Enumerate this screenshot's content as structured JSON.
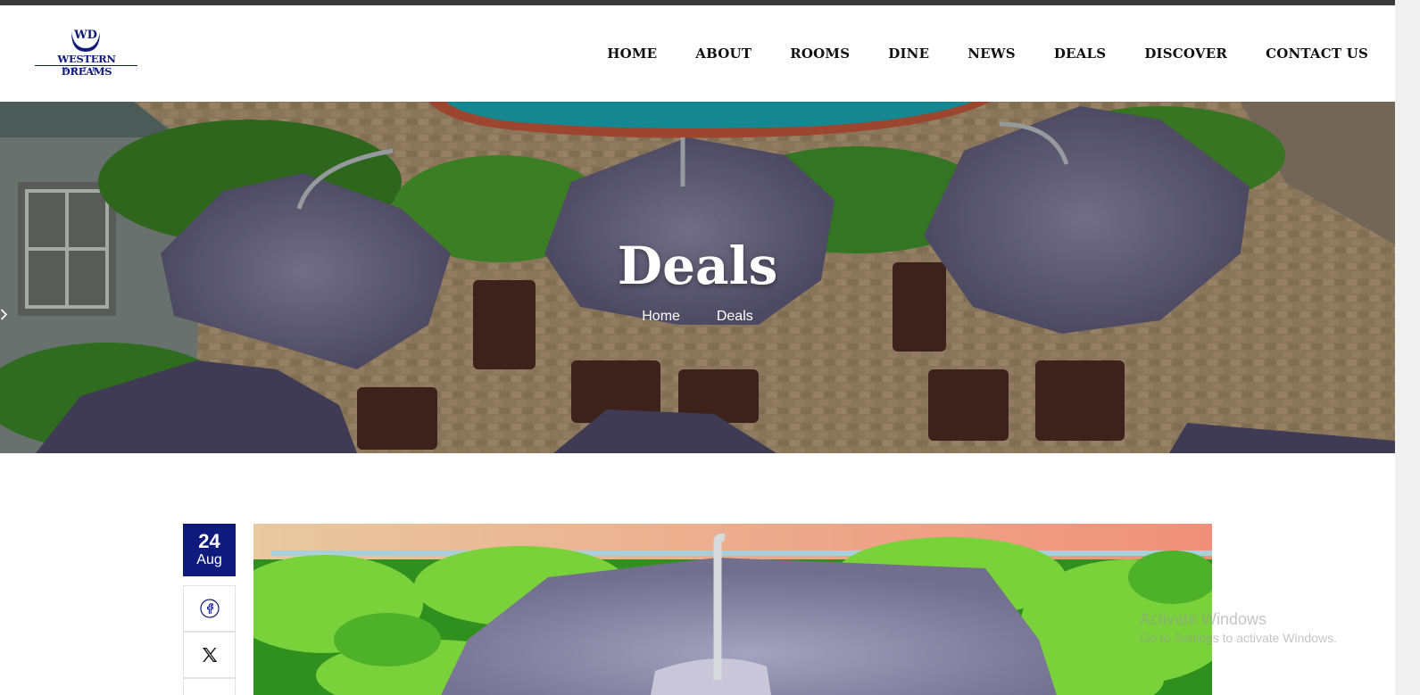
{
  "brand": {
    "logo_initials": "WD",
    "name": "WESTERN DREAMS",
    "subtitle": "HOTEL"
  },
  "nav": {
    "items": [
      {
        "label": "HOME"
      },
      {
        "label": "ABOUT"
      },
      {
        "label": "ROOMS"
      },
      {
        "label": "DINE"
      },
      {
        "label": "NEWS"
      },
      {
        "label": "DEALS"
      },
      {
        "label": "DISCOVER"
      },
      {
        "label": "CONTACT US"
      }
    ]
  },
  "hero": {
    "title": "Deals",
    "breadcrumb": {
      "home": "Home",
      "current": "Deals"
    }
  },
  "post": {
    "date_day": "24",
    "date_month": "Aug",
    "share_icons": [
      "facebook-icon",
      "x-icon"
    ]
  },
  "os_watermark": {
    "line1": "Activate Windows",
    "line2": "Go to Settings to activate Windows."
  },
  "colors": {
    "brand_navy": "#0e1a7c",
    "umbrella": "#6e6a86",
    "foliage": "#3f8f2a"
  }
}
